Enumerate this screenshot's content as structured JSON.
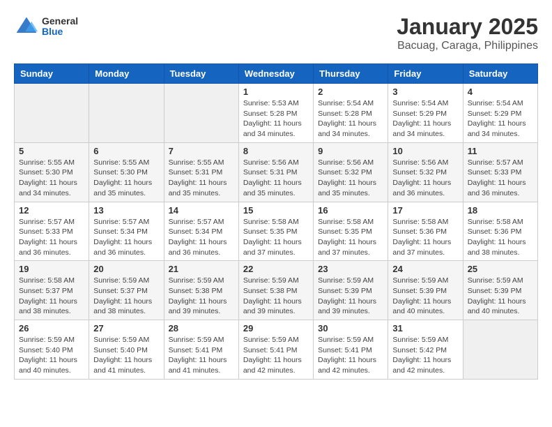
{
  "header": {
    "logo_general": "General",
    "logo_blue": "Blue",
    "title": "January 2025",
    "subtitle": "Bacuag, Caraga, Philippines"
  },
  "calendar": {
    "days_of_week": [
      "Sunday",
      "Monday",
      "Tuesday",
      "Wednesday",
      "Thursday",
      "Friday",
      "Saturday"
    ],
    "weeks": [
      [
        {
          "day": "",
          "info": ""
        },
        {
          "day": "",
          "info": ""
        },
        {
          "day": "",
          "info": ""
        },
        {
          "day": "1",
          "info": "Sunrise: 5:53 AM\nSunset: 5:28 PM\nDaylight: 11 hours\nand 34 minutes."
        },
        {
          "day": "2",
          "info": "Sunrise: 5:54 AM\nSunset: 5:28 PM\nDaylight: 11 hours\nand 34 minutes."
        },
        {
          "day": "3",
          "info": "Sunrise: 5:54 AM\nSunset: 5:29 PM\nDaylight: 11 hours\nand 34 minutes."
        },
        {
          "day": "4",
          "info": "Sunrise: 5:54 AM\nSunset: 5:29 PM\nDaylight: 11 hours\nand 34 minutes."
        }
      ],
      [
        {
          "day": "5",
          "info": "Sunrise: 5:55 AM\nSunset: 5:30 PM\nDaylight: 11 hours\nand 34 minutes."
        },
        {
          "day": "6",
          "info": "Sunrise: 5:55 AM\nSunset: 5:30 PM\nDaylight: 11 hours\nand 35 minutes."
        },
        {
          "day": "7",
          "info": "Sunrise: 5:55 AM\nSunset: 5:31 PM\nDaylight: 11 hours\nand 35 minutes."
        },
        {
          "day": "8",
          "info": "Sunrise: 5:56 AM\nSunset: 5:31 PM\nDaylight: 11 hours\nand 35 minutes."
        },
        {
          "day": "9",
          "info": "Sunrise: 5:56 AM\nSunset: 5:32 PM\nDaylight: 11 hours\nand 35 minutes."
        },
        {
          "day": "10",
          "info": "Sunrise: 5:56 AM\nSunset: 5:32 PM\nDaylight: 11 hours\nand 36 minutes."
        },
        {
          "day": "11",
          "info": "Sunrise: 5:57 AM\nSunset: 5:33 PM\nDaylight: 11 hours\nand 36 minutes."
        }
      ],
      [
        {
          "day": "12",
          "info": "Sunrise: 5:57 AM\nSunset: 5:33 PM\nDaylight: 11 hours\nand 36 minutes."
        },
        {
          "day": "13",
          "info": "Sunrise: 5:57 AM\nSunset: 5:34 PM\nDaylight: 11 hours\nand 36 minutes."
        },
        {
          "day": "14",
          "info": "Sunrise: 5:57 AM\nSunset: 5:34 PM\nDaylight: 11 hours\nand 36 minutes."
        },
        {
          "day": "15",
          "info": "Sunrise: 5:58 AM\nSunset: 5:35 PM\nDaylight: 11 hours\nand 37 minutes."
        },
        {
          "day": "16",
          "info": "Sunrise: 5:58 AM\nSunset: 5:35 PM\nDaylight: 11 hours\nand 37 minutes."
        },
        {
          "day": "17",
          "info": "Sunrise: 5:58 AM\nSunset: 5:36 PM\nDaylight: 11 hours\nand 37 minutes."
        },
        {
          "day": "18",
          "info": "Sunrise: 5:58 AM\nSunset: 5:36 PM\nDaylight: 11 hours\nand 38 minutes."
        }
      ],
      [
        {
          "day": "19",
          "info": "Sunrise: 5:58 AM\nSunset: 5:37 PM\nDaylight: 11 hours\nand 38 minutes."
        },
        {
          "day": "20",
          "info": "Sunrise: 5:59 AM\nSunset: 5:37 PM\nDaylight: 11 hours\nand 38 minutes."
        },
        {
          "day": "21",
          "info": "Sunrise: 5:59 AM\nSunset: 5:38 PM\nDaylight: 11 hours\nand 39 minutes."
        },
        {
          "day": "22",
          "info": "Sunrise: 5:59 AM\nSunset: 5:38 PM\nDaylight: 11 hours\nand 39 minutes."
        },
        {
          "day": "23",
          "info": "Sunrise: 5:59 AM\nSunset: 5:39 PM\nDaylight: 11 hours\nand 39 minutes."
        },
        {
          "day": "24",
          "info": "Sunrise: 5:59 AM\nSunset: 5:39 PM\nDaylight: 11 hours\nand 40 minutes."
        },
        {
          "day": "25",
          "info": "Sunrise: 5:59 AM\nSunset: 5:39 PM\nDaylight: 11 hours\nand 40 minutes."
        }
      ],
      [
        {
          "day": "26",
          "info": "Sunrise: 5:59 AM\nSunset: 5:40 PM\nDaylight: 11 hours\nand 40 minutes."
        },
        {
          "day": "27",
          "info": "Sunrise: 5:59 AM\nSunset: 5:40 PM\nDaylight: 11 hours\nand 41 minutes."
        },
        {
          "day": "28",
          "info": "Sunrise: 5:59 AM\nSunset: 5:41 PM\nDaylight: 11 hours\nand 41 minutes."
        },
        {
          "day": "29",
          "info": "Sunrise: 5:59 AM\nSunset: 5:41 PM\nDaylight: 11 hours\nand 42 minutes."
        },
        {
          "day": "30",
          "info": "Sunrise: 5:59 AM\nSunset: 5:41 PM\nDaylight: 11 hours\nand 42 minutes."
        },
        {
          "day": "31",
          "info": "Sunrise: 5:59 AM\nSunset: 5:42 PM\nDaylight: 11 hours\nand 42 minutes."
        },
        {
          "day": "",
          "info": ""
        }
      ]
    ]
  }
}
